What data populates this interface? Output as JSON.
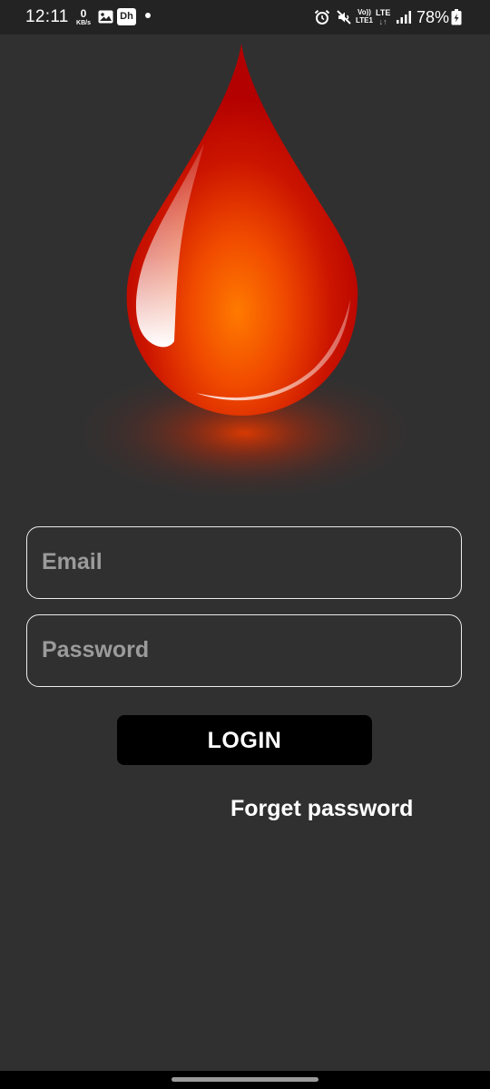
{
  "status_bar": {
    "time": "12:11",
    "net_speed_value": "0",
    "net_speed_unit": "KB/s",
    "app_badge": "Dh",
    "volte_top": "Vo))",
    "volte_bottom": "LTE1",
    "lte_top": "LTE",
    "lte_bottom": "↓↑",
    "battery_percent": "78%",
    "icons": [
      "gallery-icon",
      "dh-app-icon",
      "notification-dot",
      "alarm-icon",
      "mute-icon",
      "signal-icon",
      "battery-icon"
    ]
  },
  "logo": {
    "icon": "blood-drop",
    "colors": {
      "drop_dark": "#b50000",
      "drop_mid": "#e03000",
      "drop_glow": "#ff7a00",
      "shadow_glow": "#d02a00"
    }
  },
  "form": {
    "email_placeholder": "Email",
    "password_placeholder": "Password",
    "login_label": "LOGIN",
    "forget_label": "Forget password"
  },
  "theme": {
    "background": "#303030",
    "status_bar_bg": "#232323",
    "button_bg": "#000000",
    "field_border": "#ececec",
    "placeholder_color": "#9b9b9b"
  }
}
